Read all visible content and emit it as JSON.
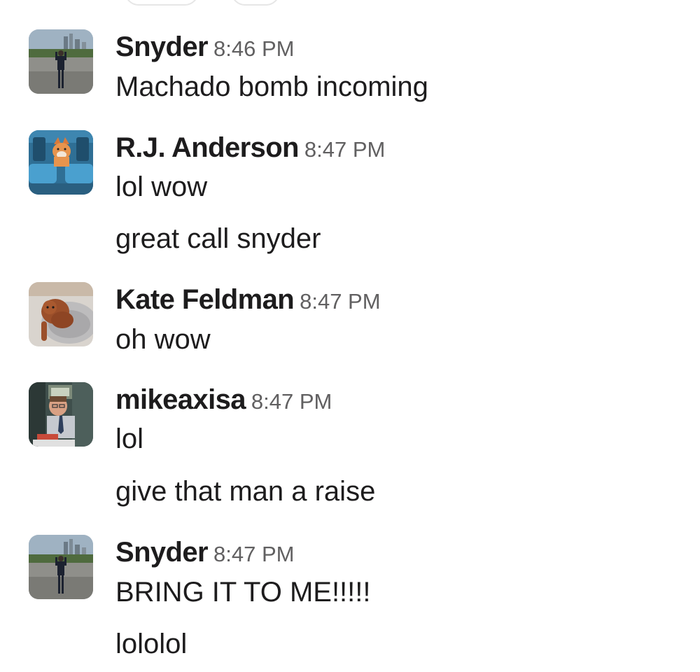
{
  "messages": [
    {
      "author": "Snyder",
      "time": "8:46 PM",
      "lines": [
        "Machado bomb incoming"
      ],
      "avatar": "stadium-city-avatar"
    },
    {
      "author": "R.J. Anderson",
      "time": "8:47 PM",
      "lines": [
        "lol wow",
        "great call snyder"
      ],
      "avatar": "fox-in-seats-avatar"
    },
    {
      "author": "Kate Feldman",
      "time": "8:47 PM",
      "lines": [
        "oh wow"
      ],
      "avatar": "dog-in-bed-avatar"
    },
    {
      "author": "mikeaxisa",
      "time": "8:47 PM",
      "lines": [
        "lol",
        "give that man a raise"
      ],
      "avatar": "office-man-avatar"
    },
    {
      "author": "Snyder",
      "time": "8:47 PM",
      "lines": [
        "BRING IT TO ME!!!!!",
        "lololol"
      ],
      "avatar": "stadium-city-avatar"
    }
  ]
}
